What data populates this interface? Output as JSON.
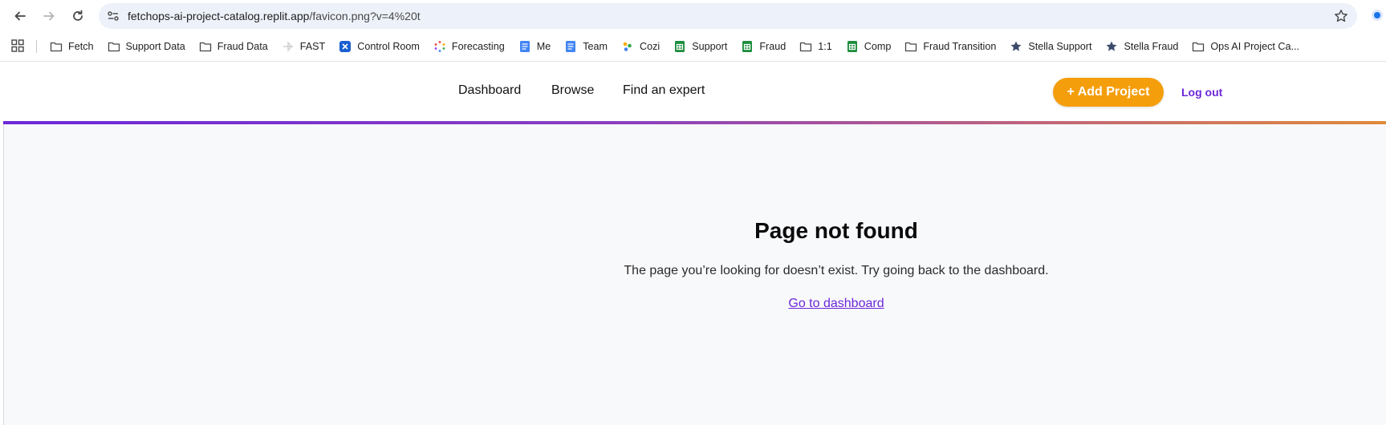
{
  "browser": {
    "url_host": "fetchops-ai-project-catalog.replit.app",
    "url_path": "/favicon.png?v=4%20t",
    "bookmarks": [
      {
        "label": "Fetch",
        "icon": "folder-icon"
      },
      {
        "label": "Support Data",
        "icon": "folder-icon"
      },
      {
        "label": "Fraud Data",
        "icon": "folder-icon"
      },
      {
        "label": "FAST",
        "icon": "fast-icon"
      },
      {
        "label": "Control Room",
        "icon": "control-room-icon"
      },
      {
        "label": "Forecasting",
        "icon": "forecasting-icon"
      },
      {
        "label": "Me",
        "icon": "docs-icon"
      },
      {
        "label": "Team",
        "icon": "docs-icon"
      },
      {
        "label": "Cozi",
        "icon": "cozi-icon"
      },
      {
        "label": "Support",
        "icon": "sheets-icon"
      },
      {
        "label": "Fraud",
        "icon": "sheets-icon"
      },
      {
        "label": "1:1",
        "icon": "folder-icon"
      },
      {
        "label": "Comp",
        "icon": "sheets-icon"
      },
      {
        "label": "Fraud Transition",
        "icon": "folder-icon"
      },
      {
        "label": "Stella Support",
        "icon": "star-icon"
      },
      {
        "label": "Stella Fraud",
        "icon": "star-icon"
      },
      {
        "label": "Ops AI Project Ca...",
        "icon": "folder-icon"
      }
    ]
  },
  "app": {
    "nav": {
      "dashboard": "Dashboard",
      "browse": "Browse",
      "find_expert": "Find an expert"
    },
    "add_project": "+ Add Project",
    "logout": "Log out"
  },
  "not_found": {
    "title": "Page not found",
    "message": "The page you’re looking for doesn’t exist. Try going back to the dashboard.",
    "link": "Go to dashboard"
  },
  "colors": {
    "accent": "#6d28d9",
    "button": "#f59e0b"
  }
}
